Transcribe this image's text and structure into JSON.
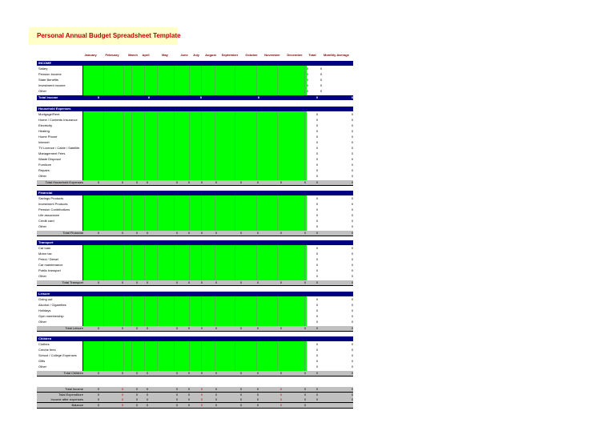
{
  "title": "Personal Annual Budget Spreadsheet Template",
  "columns": [
    "January",
    "February",
    "March",
    "April",
    "May",
    "June",
    "July",
    "August",
    "September",
    "October",
    "November",
    "December",
    "Total",
    "Monthly Average"
  ],
  "zero": "0",
  "colors": {
    "accent": "#000080",
    "input_fill": "#00ff00",
    "total_fill": "#c0c0c0",
    "title_fill": "#ffffc8",
    "title_text": "#c00000"
  },
  "sections": [
    {
      "name": "INCOME",
      "items": [
        "Salary",
        "Pension Income",
        "State Benefits",
        "Investment income",
        "Other"
      ],
      "total_label": "Total Income",
      "navy_total": true
    },
    {
      "name": "Household Expenses",
      "items": [
        "Mortgage/Rent",
        "Home / Contents Insurance",
        "Electricity",
        "Heating",
        "Home Phone",
        "Internet",
        "TV Licence / Cable / Satellite",
        "Management Fees",
        "Waste Disposal",
        "Furniture",
        "Repairs",
        "Other"
      ],
      "total_label": "Total Household Expenses"
    },
    {
      "name": "Financial",
      "items": [
        "Savings Products",
        "Investment Products",
        "Pension Contributions",
        "Life assurance",
        "Credit card",
        "Other"
      ],
      "total_label": "Total Financial"
    },
    {
      "name": "Transport",
      "items": [
        "Car loan",
        "Motor tax",
        "Petrol / Diesel",
        "Car maintenance",
        "Public transport",
        "Other"
      ],
      "total_label": "Total Transport"
    },
    {
      "name": "Leisure",
      "items": [
        "Going out",
        "Alcohol / Cigarettes",
        "Holidays",
        "Gym membership",
        "Other"
      ],
      "total_label": "Total Leisure"
    },
    {
      "name": "Children",
      "items": [
        "Clothes",
        "Creche fees",
        "School / College Expenses",
        "Gifts",
        "Other"
      ],
      "total_label": "Total Children"
    }
  ],
  "summary": [
    "Total Income",
    "Total Expenditure",
    "Income after expenses",
    "Balance"
  ]
}
